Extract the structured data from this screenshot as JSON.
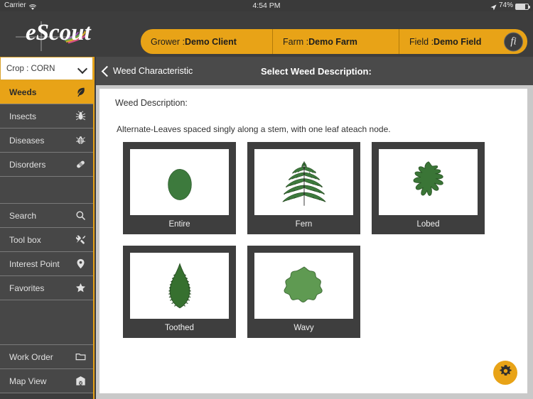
{
  "statusbar": {
    "carrier": "Carrier",
    "wifi_icon": "wifi-icon",
    "time": "4:54 PM",
    "location_icon": "location-arrow-icon",
    "battery_percent": "74%",
    "battery_icon": "battery-icon"
  },
  "header": {
    "logo_text": "eScout",
    "breadcrumbs": [
      {
        "label": "Grower :",
        "value": "Demo Client"
      },
      {
        "label": "Farm :",
        "value": "Demo Farm"
      },
      {
        "label": "Field :",
        "value": "Demo Field"
      }
    ],
    "info_badge": "fi"
  },
  "sidebar": {
    "crop": {
      "label": "Crop : CORN",
      "chevron_icon": "chevron-down-icon"
    },
    "items": [
      {
        "label": "Weeds",
        "icon": "leaf-icon",
        "active": true
      },
      {
        "label": "Insects",
        "icon": "bug-icon",
        "active": false
      },
      {
        "label": "Diseases",
        "icon": "ladybug-icon",
        "active": false
      },
      {
        "label": "Disorders",
        "icon": "bandage-icon",
        "active": false
      }
    ],
    "items2": [
      {
        "label": "Search",
        "icon": "search-icon"
      },
      {
        "label": "Tool box",
        "icon": "tools-icon"
      },
      {
        "label": "Interest Point",
        "icon": "map-pin-icon"
      },
      {
        "label": "Favorites",
        "icon": "star-icon"
      }
    ],
    "items3": [
      {
        "label": "Work Order",
        "icon": "folder-icon"
      },
      {
        "label": "Map View",
        "icon": "barn-icon"
      }
    ]
  },
  "navbar": {
    "back_label": "Weed Characteristic",
    "back_icon": "chevron-left-icon",
    "title": "Select Weed Description:"
  },
  "content": {
    "section_title": "Weed Description:",
    "description": "Alternate-Leaves spaced singly along a stem, with one leaf ateach node.",
    "cards": [
      {
        "label": "Entire",
        "icon": "leaf-entire-icon"
      },
      {
        "label": "Fern",
        "icon": "leaf-fern-icon"
      },
      {
        "label": "Lobed",
        "icon": "leaf-lobed-icon"
      },
      {
        "label": "Toothed",
        "icon": "leaf-toothed-icon"
      },
      {
        "label": "Wavy",
        "icon": "leaf-wavy-icon"
      }
    ]
  },
  "fab": {
    "icon": "gear-icon"
  },
  "colors": {
    "accent": "#e8a317",
    "dark": "#3d3d3d",
    "panel": "#474747",
    "leaf_green": "#3d7a3d",
    "leaf_green_light": "#5f9a52"
  }
}
